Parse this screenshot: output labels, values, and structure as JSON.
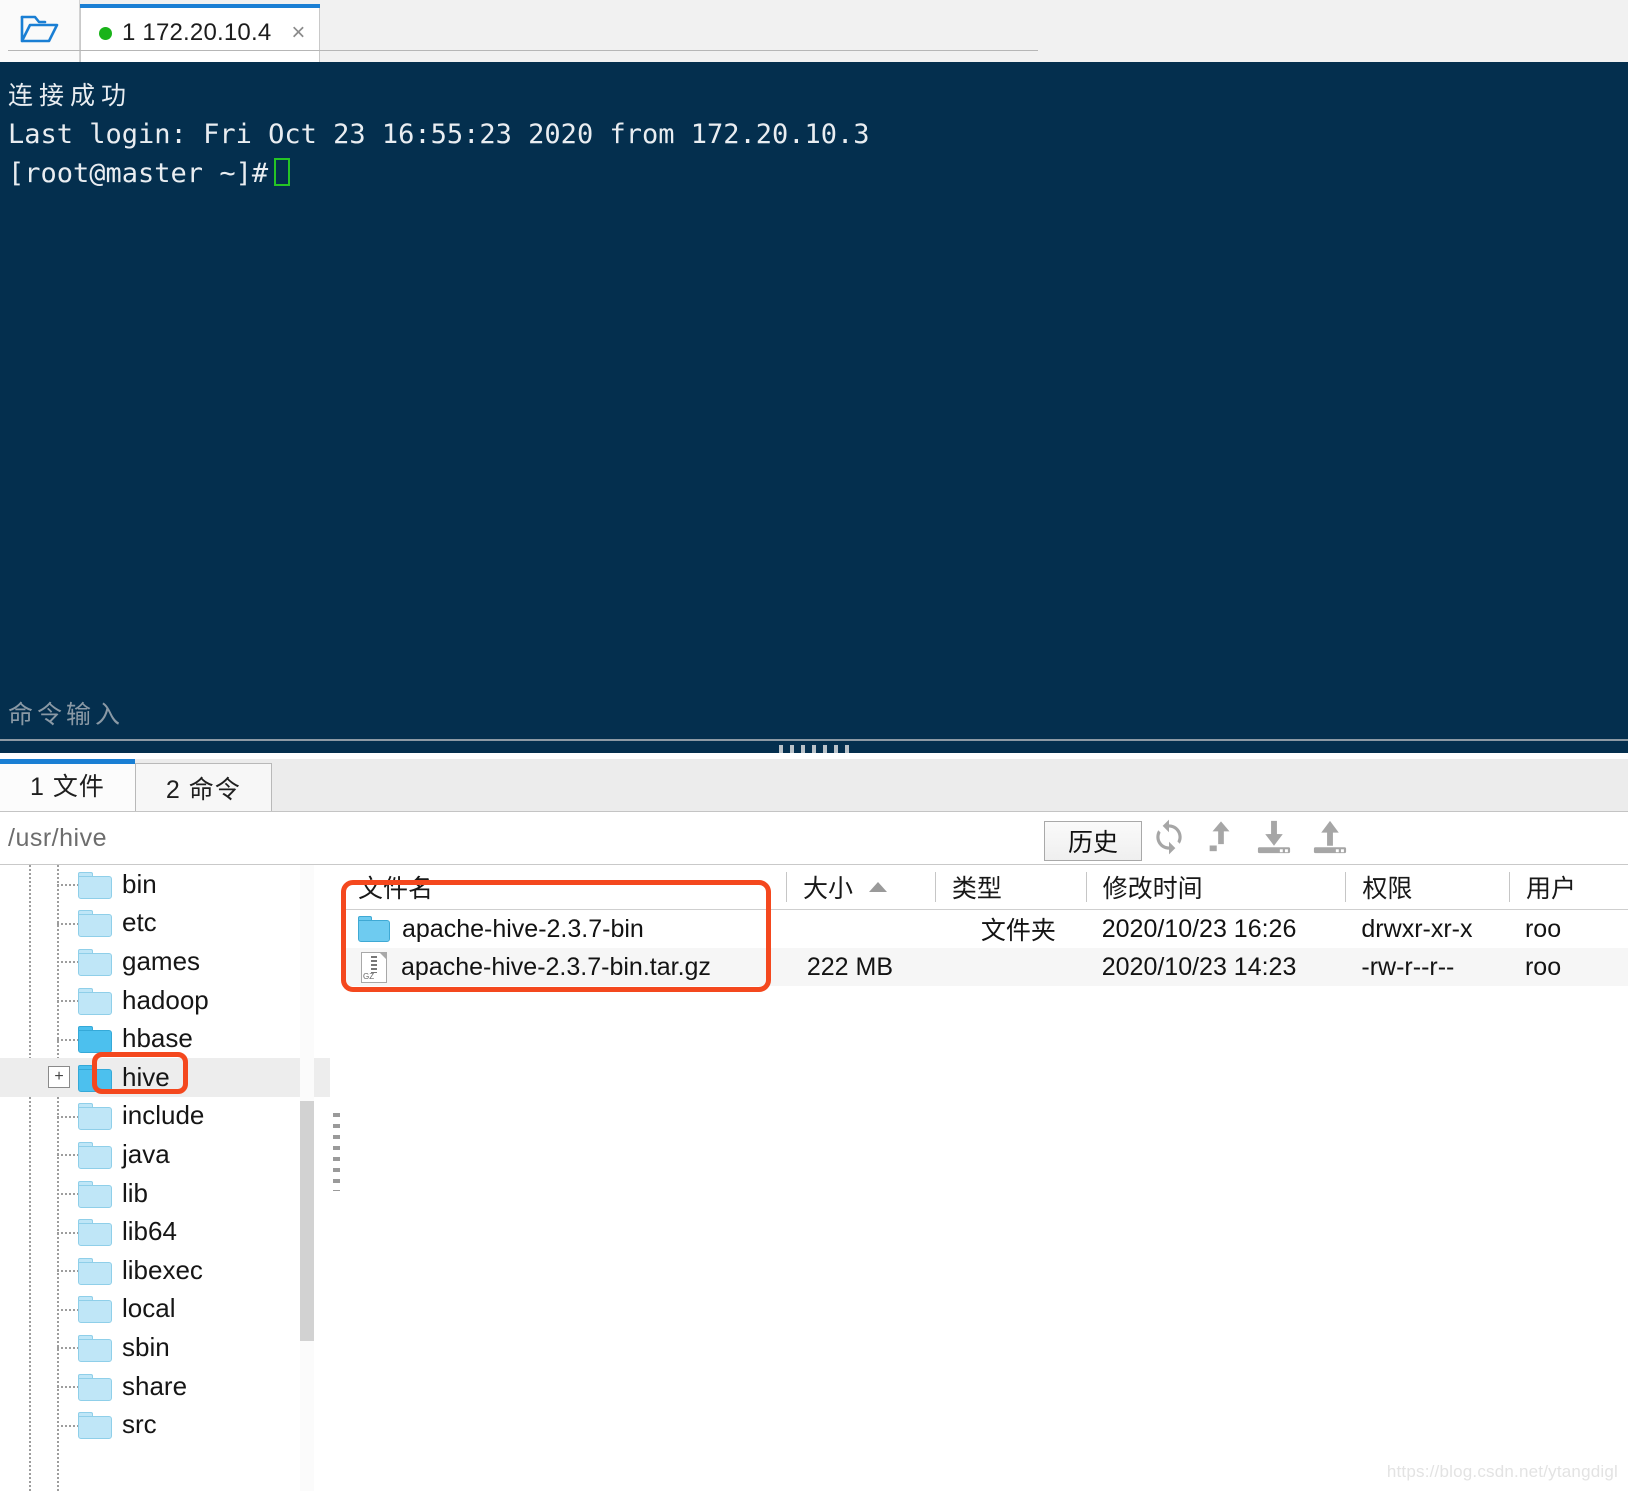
{
  "window": {
    "folder_button_icon": "open-folder-icon"
  },
  "terminal_tab": {
    "status_dot": "connected-dot",
    "label": "1 172.20.10.4",
    "close": "×"
  },
  "terminal": {
    "lines": [
      "连接成功",
      "Last login: Fri Oct 23 16:55:23 2020 from 172.20.10.3",
      "[root@master ~]#"
    ],
    "command_input_placeholder": "命令输入"
  },
  "panel_tabs": [
    {
      "label": "1 文件",
      "active": true
    },
    {
      "label": "2 命令",
      "active": false
    }
  ],
  "pathbar": {
    "path": "/usr/hive",
    "history_button": "历史",
    "icons": [
      "refresh-icon",
      "go-up-icon",
      "download-icon",
      "upload-icon"
    ]
  },
  "tree": {
    "items": [
      {
        "label": "bin",
        "folder": "light",
        "expander": false,
        "selected": false
      },
      {
        "label": "etc",
        "folder": "light",
        "expander": false,
        "selected": false
      },
      {
        "label": "games",
        "folder": "light",
        "expander": false,
        "selected": false
      },
      {
        "label": "hadoop",
        "folder": "light",
        "expander": false,
        "selected": false
      },
      {
        "label": "hbase",
        "folder": "dark",
        "expander": false,
        "selected": false
      },
      {
        "label": "hive",
        "folder": "dark",
        "expander": true,
        "selected": true
      },
      {
        "label": "include",
        "folder": "light",
        "expander": false,
        "selected": false
      },
      {
        "label": "java",
        "folder": "light",
        "expander": false,
        "selected": false
      },
      {
        "label": "lib",
        "folder": "light",
        "expander": false,
        "selected": false
      },
      {
        "label": "lib64",
        "folder": "light",
        "expander": false,
        "selected": false
      },
      {
        "label": "libexec",
        "folder": "light",
        "expander": false,
        "selected": false
      },
      {
        "label": "local",
        "folder": "light",
        "expander": false,
        "selected": false
      },
      {
        "label": "sbin",
        "folder": "light",
        "expander": false,
        "selected": false
      },
      {
        "label": "share",
        "folder": "light",
        "expander": false,
        "selected": false
      },
      {
        "label": "src",
        "folder": "light",
        "expander": false,
        "selected": false
      }
    ],
    "expander_glyph": "+"
  },
  "filelist": {
    "columns": [
      {
        "key": "name",
        "label": "文件名",
        "sorted": false
      },
      {
        "key": "size",
        "label": "大小",
        "sorted": true
      },
      {
        "key": "type",
        "label": "类型",
        "sorted": false
      },
      {
        "key": "mtime",
        "label": "修改时间",
        "sorted": false
      },
      {
        "key": "perm",
        "label": "权限",
        "sorted": false
      },
      {
        "key": "user",
        "label": "用户",
        "sorted": false
      }
    ],
    "rows": [
      {
        "icon": "folder-icon",
        "name": "apache-hive-2.3.7-bin",
        "size": "",
        "type": "文件夹",
        "mtime": "2020/10/23 16:26",
        "perm": "drwxr-xr-x",
        "user": "roo"
      },
      {
        "icon": "gzip-file-icon",
        "name": "apache-hive-2.3.7-bin.tar.gz",
        "size": "222 MB",
        "type": "",
        "mtime": "2020/10/23 14:23",
        "perm": "-rw-r--r--",
        "user": "roo"
      }
    ]
  },
  "annotations": {
    "highlight_color": "#f4481e",
    "hive_tree_item": "hive",
    "file_rows": "apache-hive-2.3.7-bin rows"
  },
  "watermark": "https://blog.csdn.net/ytangdigl",
  "colors": {
    "terminal_bg": "#042f4e",
    "accent_blue": "#1a7fd4",
    "connected_green": "#19b319",
    "highlight_orange": "#f4481e"
  }
}
